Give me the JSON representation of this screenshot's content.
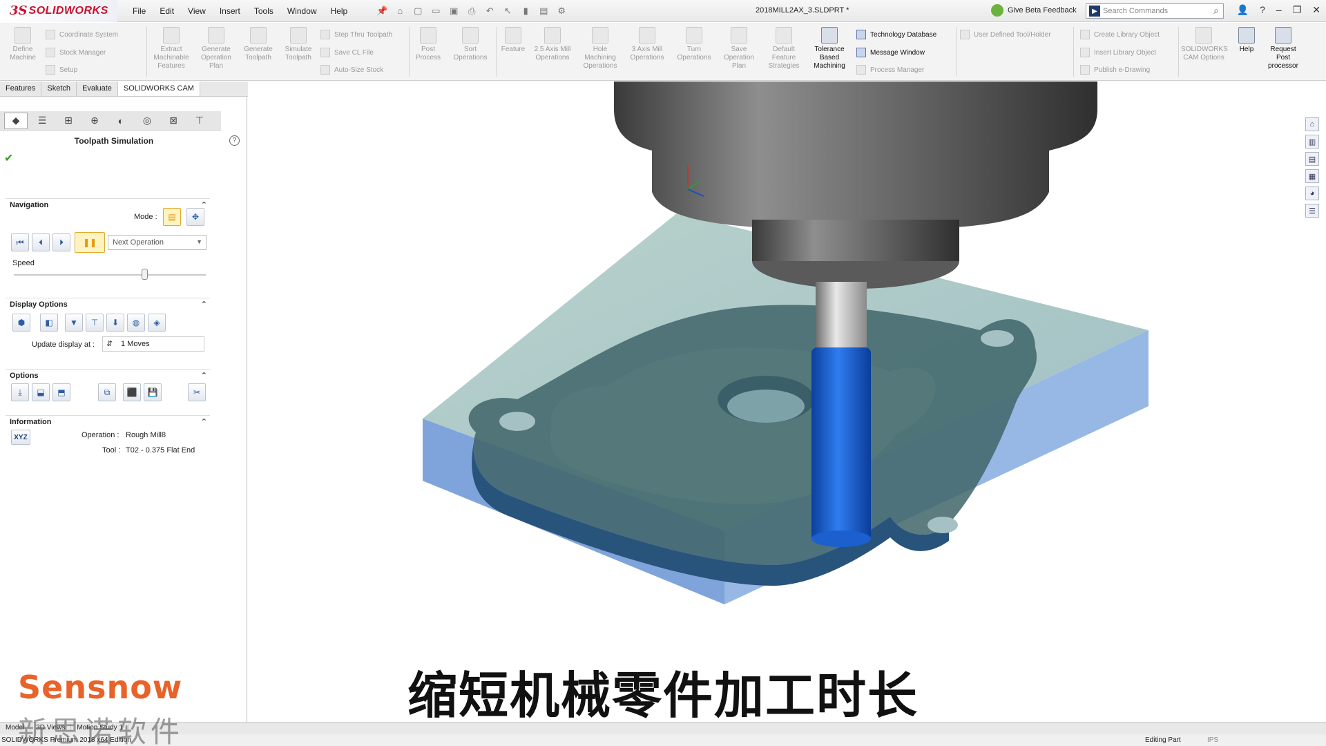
{
  "app": {
    "logo_ds": "3S",
    "logo_name": "SOLIDWORKS",
    "document_title": "2018MILL2AX_3.SLDPRT *",
    "feedback_label": "Give Beta Feedback",
    "search_placeholder": "Search Commands"
  },
  "menu": [
    "File",
    "Edit",
    "View",
    "Insert",
    "Tools",
    "Window",
    "Help"
  ],
  "ribbon": {
    "define_machine": "Define Machine",
    "coordinate_system": "Coordinate System",
    "stock_manager": "Stock Manager",
    "setup": "Setup",
    "extract_features": "Extract Machinable Features",
    "generate_plan": "Generate Operation Plan",
    "generate_toolpath": "Generate Toolpath",
    "simulate_toolpath": "Simulate Toolpath",
    "step_thru": "Step Thru Toolpath",
    "save_cl": "Save CL File",
    "auto_size_stock": "Auto-Size Stock",
    "post_process": "Post Process",
    "sort_operations": "Sort Operations",
    "feature": "Feature",
    "mill_25": "2.5 Axis Mill Operations",
    "hole_machining": "Hole Machining Operations",
    "mill_3": "3 Axis Mill Operations",
    "turn_operations": "Turn Operations",
    "save_plan": "Save Operation Plan",
    "default_strategies": "Default Feature Strategies",
    "tolerance_based": "Tolerance Based Machining",
    "technology_db": "Technology Database",
    "message_window": "Message Window",
    "process_manager": "Process Manager",
    "user_defined_tool": "User Defined Tool/Holder",
    "create_library": "Create Library Object",
    "insert_library": "Insert Library Object",
    "publish_edrawing": "Publish e-Drawing",
    "cam_options": "SOLIDWORKS CAM Options",
    "help": "Help",
    "request_post": "Request Post processor"
  },
  "cm_tabs": [
    "Features",
    "Sketch",
    "Evaluate",
    "SOLIDWORKS CAM"
  ],
  "panel": {
    "title": "Toolpath Simulation",
    "navigation": {
      "header": "Navigation",
      "mode_label": "Mode :",
      "dropdown_value": "Next Operation",
      "speed_label": "Speed",
      "speed_value": 0.68
    },
    "display_options": {
      "header": "Display Options",
      "update_label": "Update display at :",
      "update_value": "1 Moves"
    },
    "options": {
      "header": "Options"
    },
    "information": {
      "header": "Information",
      "xyz_label": "XYZ",
      "operation_label": "Operation :",
      "operation_value": "Rough Mill8",
      "tool_label": "Tool :",
      "tool_value": "T02 - 0.375 Flat End"
    }
  },
  "bottom_tabs": [
    "Model",
    "3D Views",
    "Motion Study 1"
  ],
  "status": {
    "app": "SOLIDWORKS Premium 2018 x64 Edition",
    "mode": "Editing Part",
    "units": "IPS"
  },
  "overlay": {
    "subtitle": "缩短机械零件加工时长",
    "brand": "Sensnow",
    "brand_cn": "新思诺软件"
  },
  "colors": {
    "accent": "#c8102e",
    "tool_blue": "#1f63d6",
    "stock_blue": "#8fb1df",
    "brand_orange": "#e8622a"
  }
}
